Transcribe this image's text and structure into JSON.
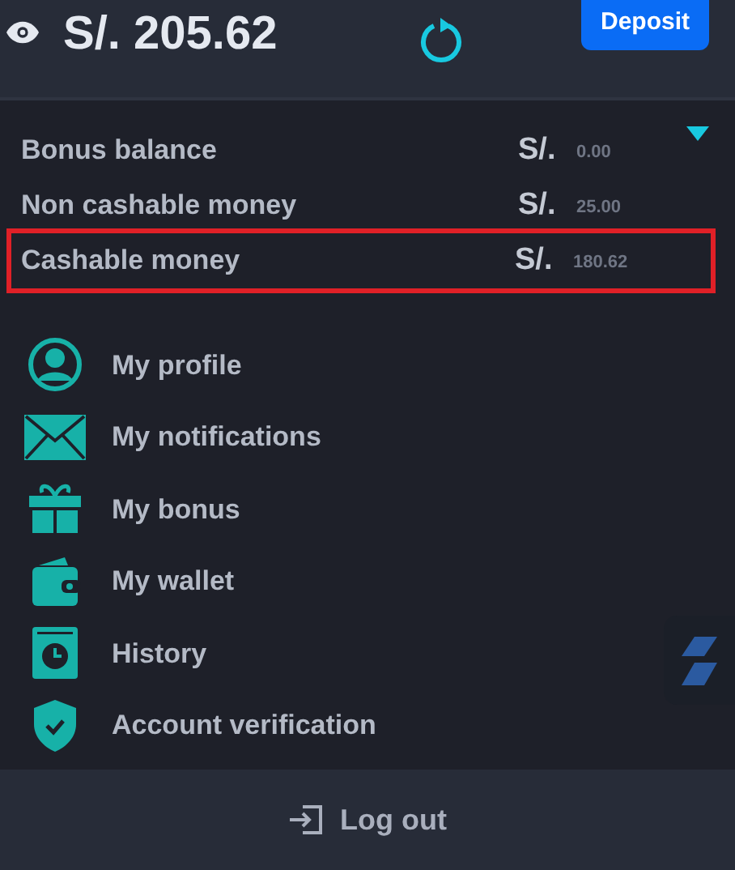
{
  "header": {
    "balance": "S/. 205.62",
    "deposit_button": "Deposit"
  },
  "balances": {
    "expanded": true,
    "rows": [
      {
        "label": "Bonus balance",
        "currency": "S/.",
        "amount": "0.00",
        "highlighted": false
      },
      {
        "label": "Non cashable money",
        "currency": "S/.",
        "amount": "25.00",
        "highlighted": false
      },
      {
        "label": "Cashable money",
        "currency": "S/.",
        "amount": "180.62",
        "highlighted": true
      }
    ]
  },
  "menu": [
    {
      "kind": "profile",
      "label": "My profile"
    },
    {
      "kind": "notifications",
      "label": "My notifications"
    },
    {
      "kind": "bonus",
      "label": "My bonus"
    },
    {
      "kind": "wallet",
      "label": "My wallet"
    },
    {
      "kind": "history",
      "label": "History"
    },
    {
      "kind": "verification",
      "label": "Account verification"
    }
  ],
  "footer": {
    "logout": "Log out"
  }
}
